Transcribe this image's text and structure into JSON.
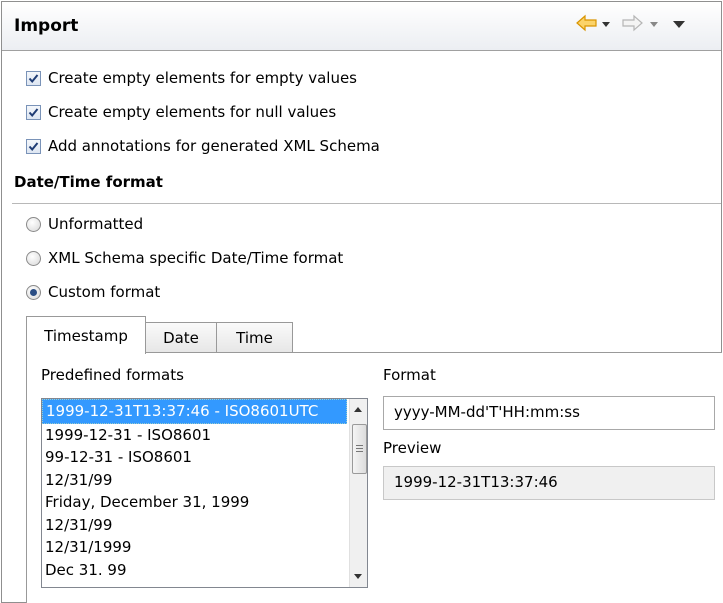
{
  "header": {
    "title": "Import",
    "icons": [
      "back-arrow-icon",
      "chevron-down-icon",
      "forward-arrow-icon",
      "chevron-down-icon",
      "view-menu-icon"
    ]
  },
  "options": [
    {
      "label": "Create empty elements for empty values",
      "checked": true
    },
    {
      "label": "Create empty elements for null values",
      "checked": true
    },
    {
      "label": "Add annotations for generated XML Schema",
      "checked": true
    }
  ],
  "datetime": {
    "section_title": "Date/Time format",
    "radios": [
      {
        "label": "Unformatted",
        "selected": false
      },
      {
        "label": "XML Schema specific Date/Time format",
        "selected": false
      },
      {
        "label": "Custom format",
        "selected": true
      }
    ]
  },
  "tabs": [
    {
      "label": "Timestamp",
      "active": true
    },
    {
      "label": "Date",
      "active": false
    },
    {
      "label": "Time",
      "active": false
    }
  ],
  "panel": {
    "predefined_label": "Predefined formats",
    "formats": [
      "1999-12-31T13:37:46 - ISO8601UTC",
      "1999-12-31 - ISO8601",
      "99-12-31 - ISO8601",
      "12/31/99",
      "Friday, December 31, 1999",
      "12/31/99",
      "12/31/1999",
      "Dec 31. 99"
    ],
    "selected_index": 0,
    "format_label": "Format",
    "format_value": "yyyy-MM-dd'T'HH:mm:ss",
    "preview_label": "Preview",
    "preview_value": "1999-12-31T13:37:46"
  },
  "colors": {
    "selection": "#3399ff",
    "back_arrow": "#f2a400"
  }
}
